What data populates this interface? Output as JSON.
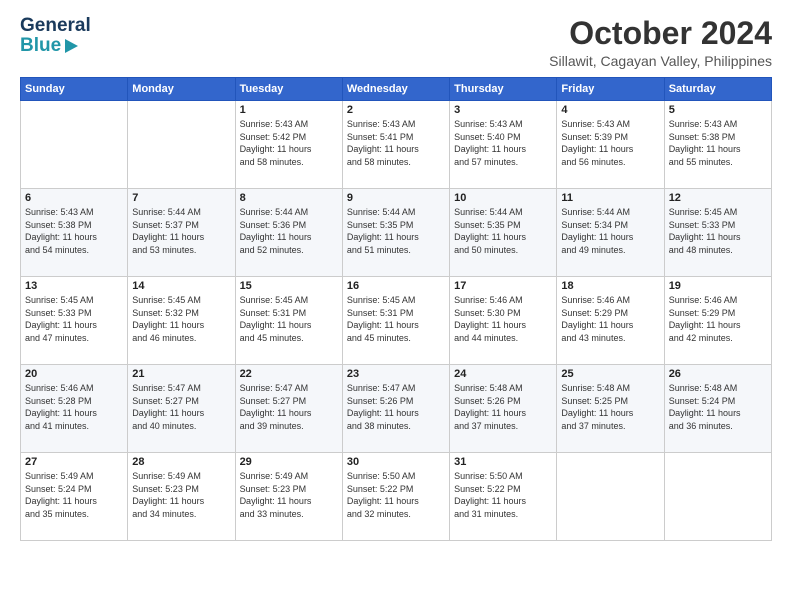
{
  "header": {
    "logo_line1": "General",
    "logo_line2": "Blue",
    "month": "October 2024",
    "location": "Sillawit, Cagayan Valley, Philippines"
  },
  "weekdays": [
    "Sunday",
    "Monday",
    "Tuesday",
    "Wednesday",
    "Thursday",
    "Friday",
    "Saturday"
  ],
  "weeks": [
    [
      {
        "day": "",
        "detail": ""
      },
      {
        "day": "",
        "detail": ""
      },
      {
        "day": "1",
        "detail": "Sunrise: 5:43 AM\nSunset: 5:42 PM\nDaylight: 11 hours\nand 58 minutes."
      },
      {
        "day": "2",
        "detail": "Sunrise: 5:43 AM\nSunset: 5:41 PM\nDaylight: 11 hours\nand 58 minutes."
      },
      {
        "day": "3",
        "detail": "Sunrise: 5:43 AM\nSunset: 5:40 PM\nDaylight: 11 hours\nand 57 minutes."
      },
      {
        "day": "4",
        "detail": "Sunrise: 5:43 AM\nSunset: 5:39 PM\nDaylight: 11 hours\nand 56 minutes."
      },
      {
        "day": "5",
        "detail": "Sunrise: 5:43 AM\nSunset: 5:38 PM\nDaylight: 11 hours\nand 55 minutes."
      }
    ],
    [
      {
        "day": "6",
        "detail": "Sunrise: 5:43 AM\nSunset: 5:38 PM\nDaylight: 11 hours\nand 54 minutes."
      },
      {
        "day": "7",
        "detail": "Sunrise: 5:44 AM\nSunset: 5:37 PM\nDaylight: 11 hours\nand 53 minutes."
      },
      {
        "day": "8",
        "detail": "Sunrise: 5:44 AM\nSunset: 5:36 PM\nDaylight: 11 hours\nand 52 minutes."
      },
      {
        "day": "9",
        "detail": "Sunrise: 5:44 AM\nSunset: 5:35 PM\nDaylight: 11 hours\nand 51 minutes."
      },
      {
        "day": "10",
        "detail": "Sunrise: 5:44 AM\nSunset: 5:35 PM\nDaylight: 11 hours\nand 50 minutes."
      },
      {
        "day": "11",
        "detail": "Sunrise: 5:44 AM\nSunset: 5:34 PM\nDaylight: 11 hours\nand 49 minutes."
      },
      {
        "day": "12",
        "detail": "Sunrise: 5:45 AM\nSunset: 5:33 PM\nDaylight: 11 hours\nand 48 minutes."
      }
    ],
    [
      {
        "day": "13",
        "detail": "Sunrise: 5:45 AM\nSunset: 5:33 PM\nDaylight: 11 hours\nand 47 minutes."
      },
      {
        "day": "14",
        "detail": "Sunrise: 5:45 AM\nSunset: 5:32 PM\nDaylight: 11 hours\nand 46 minutes."
      },
      {
        "day": "15",
        "detail": "Sunrise: 5:45 AM\nSunset: 5:31 PM\nDaylight: 11 hours\nand 45 minutes."
      },
      {
        "day": "16",
        "detail": "Sunrise: 5:45 AM\nSunset: 5:31 PM\nDaylight: 11 hours\nand 45 minutes."
      },
      {
        "day": "17",
        "detail": "Sunrise: 5:46 AM\nSunset: 5:30 PM\nDaylight: 11 hours\nand 44 minutes."
      },
      {
        "day": "18",
        "detail": "Sunrise: 5:46 AM\nSunset: 5:29 PM\nDaylight: 11 hours\nand 43 minutes."
      },
      {
        "day": "19",
        "detail": "Sunrise: 5:46 AM\nSunset: 5:29 PM\nDaylight: 11 hours\nand 42 minutes."
      }
    ],
    [
      {
        "day": "20",
        "detail": "Sunrise: 5:46 AM\nSunset: 5:28 PM\nDaylight: 11 hours\nand 41 minutes."
      },
      {
        "day": "21",
        "detail": "Sunrise: 5:47 AM\nSunset: 5:27 PM\nDaylight: 11 hours\nand 40 minutes."
      },
      {
        "day": "22",
        "detail": "Sunrise: 5:47 AM\nSunset: 5:27 PM\nDaylight: 11 hours\nand 39 minutes."
      },
      {
        "day": "23",
        "detail": "Sunrise: 5:47 AM\nSunset: 5:26 PM\nDaylight: 11 hours\nand 38 minutes."
      },
      {
        "day": "24",
        "detail": "Sunrise: 5:48 AM\nSunset: 5:26 PM\nDaylight: 11 hours\nand 37 minutes."
      },
      {
        "day": "25",
        "detail": "Sunrise: 5:48 AM\nSunset: 5:25 PM\nDaylight: 11 hours\nand 37 minutes."
      },
      {
        "day": "26",
        "detail": "Sunrise: 5:48 AM\nSunset: 5:24 PM\nDaylight: 11 hours\nand 36 minutes."
      }
    ],
    [
      {
        "day": "27",
        "detail": "Sunrise: 5:49 AM\nSunset: 5:24 PM\nDaylight: 11 hours\nand 35 minutes."
      },
      {
        "day": "28",
        "detail": "Sunrise: 5:49 AM\nSunset: 5:23 PM\nDaylight: 11 hours\nand 34 minutes."
      },
      {
        "day": "29",
        "detail": "Sunrise: 5:49 AM\nSunset: 5:23 PM\nDaylight: 11 hours\nand 33 minutes."
      },
      {
        "day": "30",
        "detail": "Sunrise: 5:50 AM\nSunset: 5:22 PM\nDaylight: 11 hours\nand 32 minutes."
      },
      {
        "day": "31",
        "detail": "Sunrise: 5:50 AM\nSunset: 5:22 PM\nDaylight: 11 hours\nand 31 minutes."
      },
      {
        "day": "",
        "detail": ""
      },
      {
        "day": "",
        "detail": ""
      }
    ]
  ]
}
